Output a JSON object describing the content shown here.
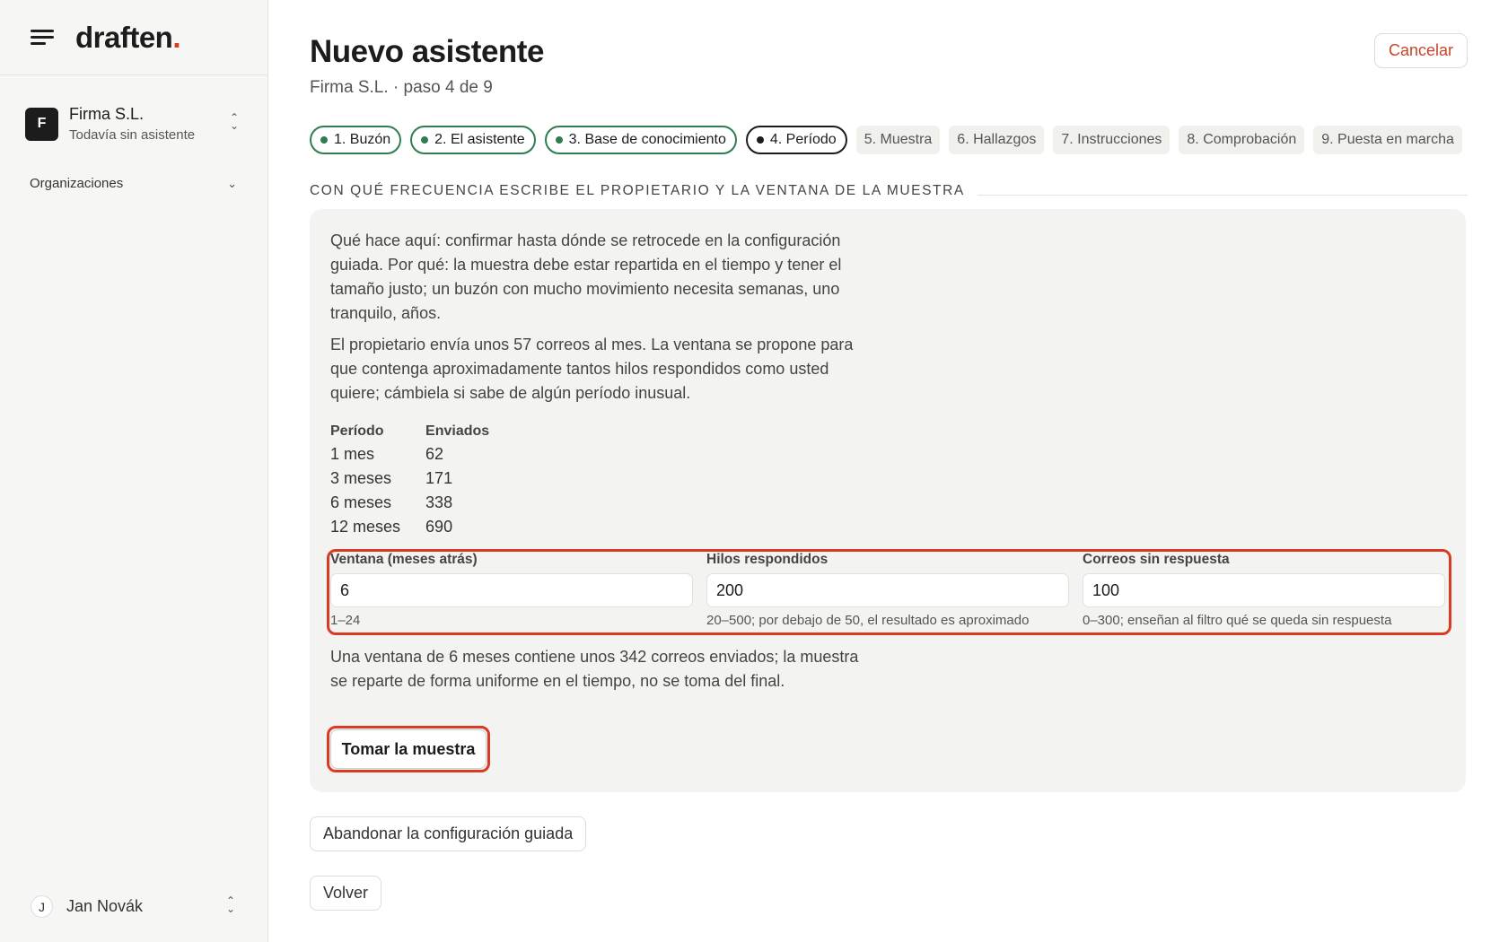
{
  "app": {
    "logo": "draften",
    "logo_dot": "."
  },
  "sidebar": {
    "org_initial": "F",
    "org_name": "Firma S.L.",
    "org_sub": "Todavía sin asistente",
    "section_label": "Organizaciones",
    "user_initial": "J",
    "user_name": "Jan Novák"
  },
  "header": {
    "title": "Nuevo asistente",
    "subtitle": "Firma S.L. · paso 4 de 9",
    "cancel_label": "Cancelar"
  },
  "steps": [
    {
      "label": "1. Buzón",
      "state": "done"
    },
    {
      "label": "2. El asistente",
      "state": "done"
    },
    {
      "label": "3. Base de conocimiento",
      "state": "done"
    },
    {
      "label": "4. Período",
      "state": "active"
    },
    {
      "label": "5. Muestra",
      "state": "todo"
    },
    {
      "label": "6. Hallazgos",
      "state": "todo"
    },
    {
      "label": "7. Instrucciones",
      "state": "todo"
    },
    {
      "label": "8. Comprobación",
      "state": "todo"
    },
    {
      "label": "9. Puesta en marcha",
      "state": "todo"
    }
  ],
  "section": {
    "title": "CON QUÉ FRECUENCIA ESCRIBE EL PROPIETARIO Y LA VENTANA DE LA MUESTRA"
  },
  "card": {
    "intro": "Qué hace aquí: confirmar hasta dónde se retrocede en la configuración guiada. Por qué: la muestra debe estar repartida en el tiempo y tener el tamaño justo; un buzón con mucho movimiento necesita semanas, uno tranquilo, años.",
    "owner_info": "El propietario envía unos 57 correos al mes. La ventana se propone para que contenga aproximadamente tantos hilos respondidos como usted quiere; cámbiela si sabe de algún período inusual.",
    "table": {
      "headers": [
        "Período",
        "Enviados"
      ],
      "rows": [
        [
          "1 mes",
          "62"
        ],
        [
          "3 meses",
          "171"
        ],
        [
          "6 meses",
          "338"
        ],
        [
          "12 meses",
          "690"
        ]
      ]
    },
    "fields": [
      {
        "label": "Ventana (meses atrás)",
        "value": "6",
        "hint": "1–24"
      },
      {
        "label": "Hilos respondidos",
        "value": "200",
        "hint": "20–500; por debajo de 50, el resultado es aproximado"
      },
      {
        "label": "Correos sin respuesta",
        "value": "100",
        "hint": "0–300; enseñan al filtro qué se queda sin respuesta"
      }
    ],
    "window_summary": "Una ventana de 6 meses contiene unos 342 correos enviados; la muestra se reparte de forma uniforme en el tiempo, no se toma del final.",
    "take_sample_label": "Tomar la muestra"
  },
  "actions": {
    "abandon_label": "Abandonar la configuración guiada",
    "back_label": "Volver"
  },
  "colors": {
    "accent": "#d93b22",
    "done_step": "#2e7d4f",
    "cancel_text": "#c8452c"
  }
}
